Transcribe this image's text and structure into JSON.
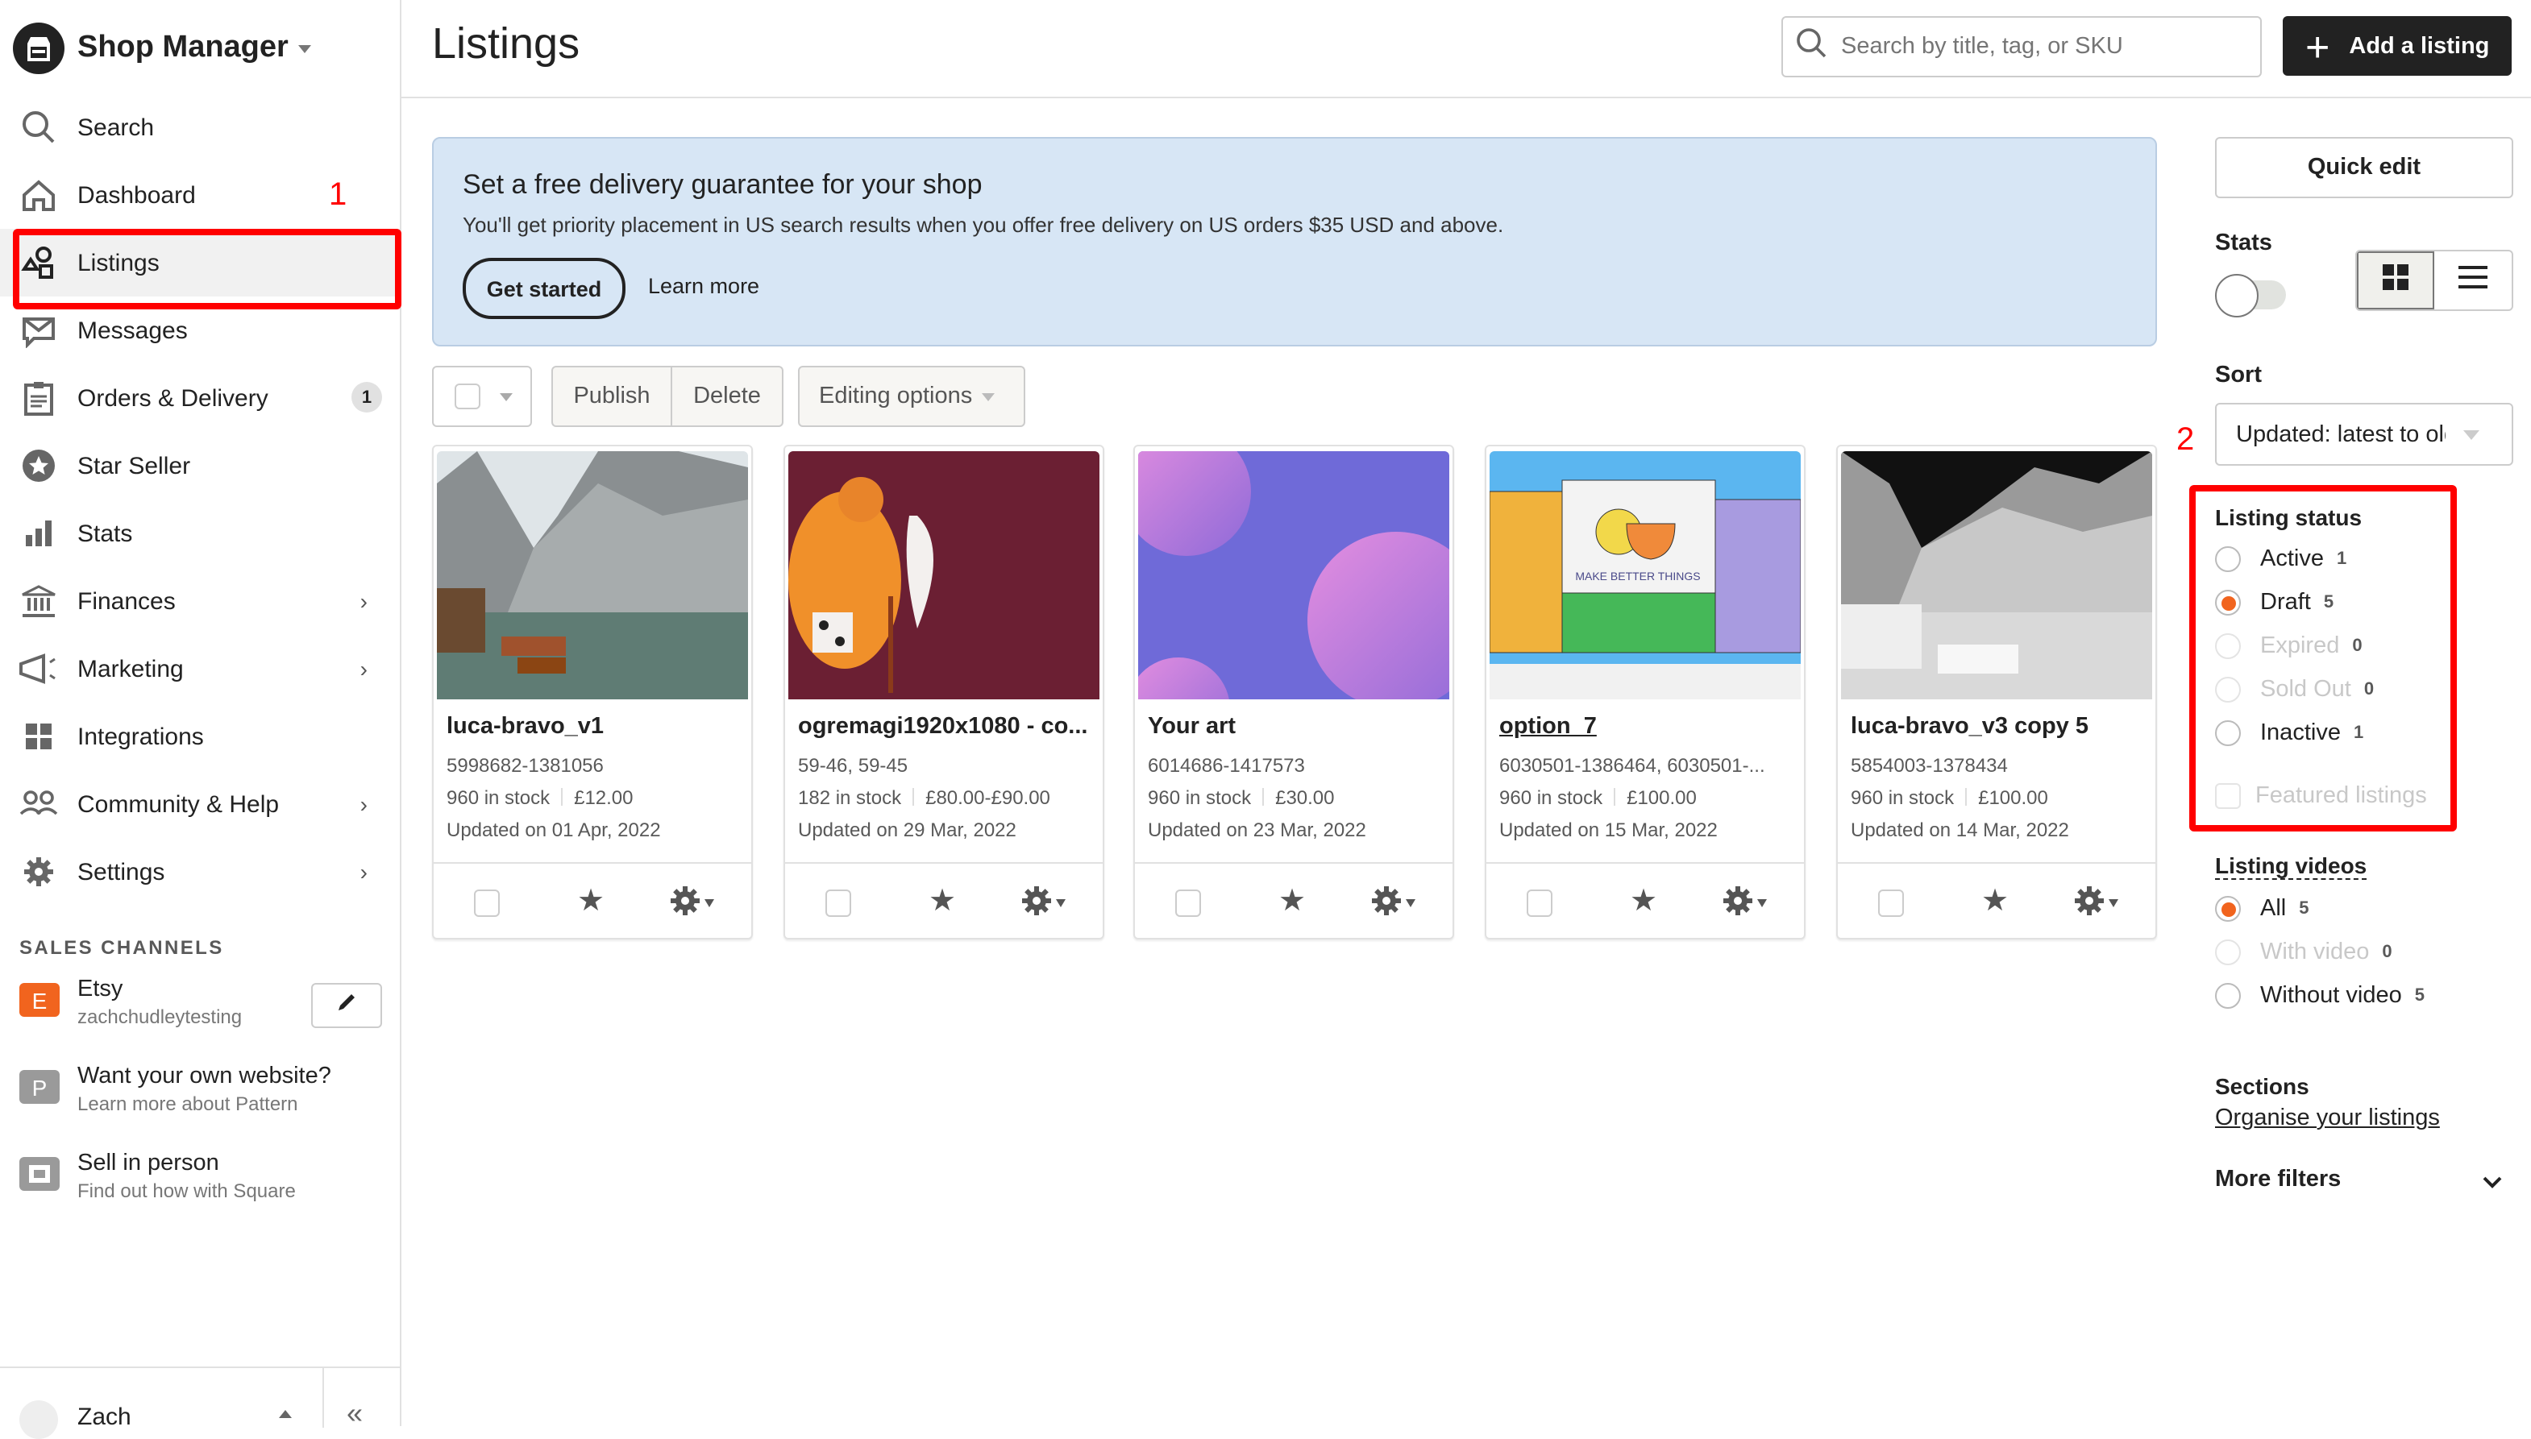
{
  "sidebar": {
    "brand_title": "Shop Manager",
    "nav": [
      {
        "label": "Search",
        "icon": "search-icon"
      },
      {
        "label": "Dashboard",
        "icon": "home-icon"
      },
      {
        "label": "Listings",
        "icon": "shapes-icon",
        "active": true
      },
      {
        "label": "Messages",
        "icon": "message-icon"
      },
      {
        "label": "Orders & Delivery",
        "icon": "clipboard-icon",
        "badge": "1"
      },
      {
        "label": "Star Seller",
        "icon": "star-badge-icon"
      },
      {
        "label": "Stats",
        "icon": "bar-chart-icon"
      },
      {
        "label": "Finances",
        "icon": "bank-icon",
        "chevron": true
      },
      {
        "label": "Marketing",
        "icon": "megaphone-icon",
        "chevron": true
      },
      {
        "label": "Integrations",
        "icon": "grid-icon"
      },
      {
        "label": "Community & Help",
        "icon": "people-icon",
        "chevron": true
      },
      {
        "label": "Settings",
        "icon": "gear-icon",
        "chevron": true
      }
    ],
    "sales_channels_heading": "SALES CHANNELS",
    "channels": [
      {
        "badge": "E",
        "title": "Etsy",
        "subtitle": "zachchudleytesting",
        "badge_color": "#f1641e"
      },
      {
        "badge": "P",
        "title": "Want your own website?",
        "subtitle": "Learn more about Pattern",
        "badge_color": "#9a9a9a"
      },
      {
        "badge": "",
        "title": "Sell in person",
        "subtitle": "Find out how with Square",
        "badge_color": "#9a9a9a"
      }
    ],
    "user_name": "Zach"
  },
  "annotations": {
    "one": "1",
    "two": "2"
  },
  "header": {
    "title": "Listings",
    "search_placeholder": "Search by title, tag, or SKU",
    "add_label": "Add a listing"
  },
  "banner": {
    "title": "Set a free delivery guarantee for your shop",
    "text": "You'll get priority placement in US search results when you offer free delivery on US orders $35 USD and above.",
    "primary": "Get started",
    "secondary": "Learn more"
  },
  "toolbar": {
    "publish": "Publish",
    "delete": "Delete",
    "editing_options": "Editing options"
  },
  "listings": [
    {
      "title": "luca-bravo_v1",
      "sku": "5998682-1381056",
      "stock": "960 in stock",
      "price": "£12.00",
      "updated": "Updated on 01 Apr, 2022"
    },
    {
      "title": "ogremagi1920x1080 - co...",
      "sku": "59-46, 59-45",
      "stock": "182 in stock",
      "price": "£80.00-£90.00",
      "updated": "Updated on 29 Mar, 2022"
    },
    {
      "title": "Your art",
      "sku": "6014686-1417573",
      "stock": "960 in stock",
      "price": "£30.00",
      "updated": "Updated on 23 Mar, 2022"
    },
    {
      "title": "option_7",
      "sku": "6030501-1386464, 6030501-...",
      "stock": "960 in stock",
      "price": "£100.00",
      "updated": "Updated on 15 Mar, 2022",
      "thumb_caption": "MAKE BETTER THINGS"
    },
    {
      "title": "luca-bravo_v3 copy 5",
      "sku": "5854003-1378434",
      "stock": "960 in stock",
      "price": "£100.00",
      "updated": "Updated on 14 Mar, 2022"
    }
  ],
  "panel": {
    "quick_edit": "Quick edit",
    "stats_label": "Stats",
    "stats_enabled": false,
    "view_mode": "grid",
    "sort_label": "Sort",
    "sort_value": "Updated: latest to oldest",
    "status_label": "Listing status",
    "status_options": [
      {
        "label": "Active",
        "count": "1",
        "selected": false,
        "disabled": false
      },
      {
        "label": "Draft",
        "count": "5",
        "selected": true,
        "disabled": false
      },
      {
        "label": "Expired",
        "count": "0",
        "selected": false,
        "disabled": true
      },
      {
        "label": "Sold Out",
        "count": "0",
        "selected": false,
        "disabled": true
      },
      {
        "label": "Inactive",
        "count": "1",
        "selected": false,
        "disabled": false
      }
    ],
    "featured_label": "Featured listings",
    "videos_label": "Listing videos",
    "video_options": [
      {
        "label": "All",
        "count": "5",
        "selected": true,
        "disabled": false
      },
      {
        "label": "With video",
        "count": "0",
        "selected": false,
        "disabled": true
      },
      {
        "label": "Without video",
        "count": "5",
        "selected": false,
        "disabled": false
      }
    ],
    "sections_label": "Sections",
    "organise_link": "Organise your listings",
    "more_filters": "More filters"
  },
  "colors": {
    "accent": "#f1641e",
    "annotation": "#ff0000",
    "banner_bg": "#d7e6f5",
    "dark": "#222222"
  }
}
